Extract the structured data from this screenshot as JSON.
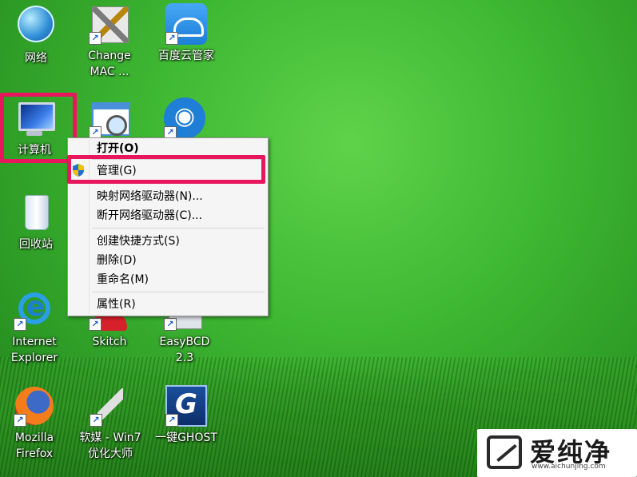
{
  "desktop": {
    "icons": [
      {
        "name": "网络",
        "icon": "network-globe-icon",
        "shortcut": false
      },
      {
        "name": "Change\nMAC ...",
        "icon": "change-mac-tools-icon",
        "shortcut": true
      },
      {
        "name": "百度云管家",
        "icon": "baidu-cloud-icon",
        "shortcut": true
      },
      {
        "name": "计算机",
        "icon": "computer-monitor-icon",
        "shortcut": false
      },
      {
        "name": "",
        "icon": "window-magnifier-icon",
        "shortcut": true
      },
      {
        "name": "",
        "icon": "wifi-icon",
        "shortcut": true
      },
      {
        "name": "回收站",
        "icon": "recycle-bin-icon",
        "shortcut": false
      },
      {
        "name": "Internet\nExplorer",
        "icon": "internet-explorer-icon",
        "shortcut": true
      },
      {
        "name": "Skitch",
        "icon": "skitch-icon",
        "shortcut": true
      },
      {
        "name": "EasyBCD\n2.3",
        "icon": "easybcd-icon",
        "shortcut": true
      },
      {
        "name": "Mozilla\nFirefox",
        "icon": "firefox-icon",
        "shortcut": true
      },
      {
        "name": "软媒 - Win7\n优化大师",
        "icon": "ruanmei-tool-icon",
        "shortcut": true
      },
      {
        "name": "一键GHOST",
        "icon": "ghost-icon",
        "shortcut": true
      }
    ]
  },
  "context_menu": {
    "items": [
      {
        "label": "打开(O)",
        "bold": true
      },
      {
        "label": "管理(G)",
        "bold": false,
        "shield": true
      },
      {
        "label": "映射网络驱动器(N)...",
        "bold": false
      },
      {
        "label": "断开网络驱动器(C)...",
        "bold": false
      },
      {
        "label": "创建快捷方式(S)",
        "bold": false
      },
      {
        "label": "删除(D)",
        "bold": false
      },
      {
        "label": "重命名(M)",
        "bold": false
      },
      {
        "label": "属性(R)",
        "bold": false
      }
    ]
  },
  "watermark": {
    "text": "爱纯净",
    "url": "www.aichunjing.com"
  },
  "colors": {
    "highlight": "#e8175d",
    "desktop_green": "#3fb833"
  }
}
